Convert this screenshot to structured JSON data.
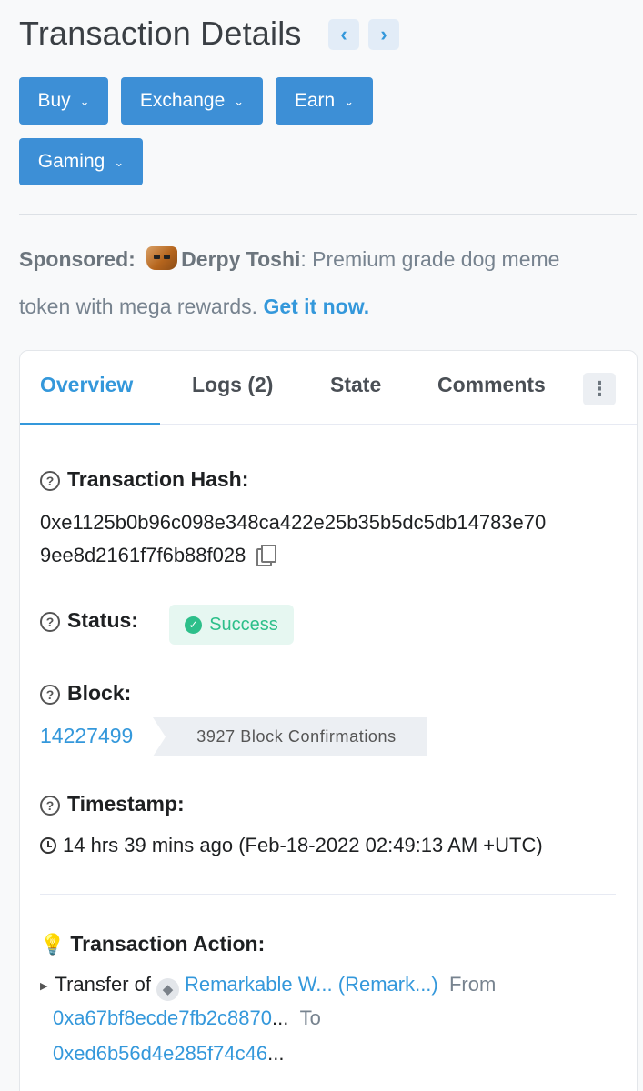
{
  "header": {
    "title": "Transaction Details",
    "prev_icon": "chevron-left-icon",
    "next_icon": "chevron-right-icon",
    "prev_glyph": "‹",
    "next_glyph": "›"
  },
  "menu": {
    "buy": "Buy",
    "exchange": "Exchange",
    "earn": "Earn",
    "gaming": "Gaming",
    "chevron": "⌄"
  },
  "sponsored": {
    "label": "Sponsored:",
    "name": "Derpy Toshi",
    "text_part1": ": Premium grade dog meme",
    "text_part2": "token with mega rewards. ",
    "cta": "Get it now."
  },
  "tabs": {
    "overview": "Overview",
    "logs": "Logs (2)",
    "state": "State",
    "comments": "Comments",
    "more_glyph": "⋮"
  },
  "details": {
    "hash_label": "Transaction Hash:",
    "hash_line1": "0xe1125b0b96c098e348ca422e25b35b5dc5db14783e70",
    "hash_line2": "9ee8d2161f7f6b88f028",
    "status_label": "Status:",
    "status_value": "Success",
    "block_label": "Block:",
    "block_number": "14227499",
    "block_confirmations": "3927 Block Confirmations",
    "timestamp_label": "Timestamp:",
    "timestamp_value": "14 hrs 39 mins ago (Feb-18-2022 02:49:13 AM +UTC)",
    "action_label": "Transaction Action:",
    "action_prefix": "Transfer of",
    "action_token": "Remarkable W... (Remark...)",
    "action_from": "From",
    "action_from_addr": "0xa67bf8ecde7fb2c8870",
    "action_to": "To",
    "action_to_addr": "0xed6b56d4e285f74c46",
    "ellipsis": "..."
  },
  "colors": {
    "primary": "#3d8fd6",
    "link": "#3498db",
    "success": "#2dbf8a"
  }
}
